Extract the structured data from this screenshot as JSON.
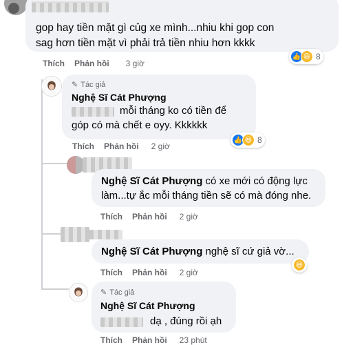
{
  "comment1": {
    "text": "gop hay tiền mặt gì củg xe mình...nhiu khi gop con sag hơn tiền mặt vì phải trả tiền nhiu hơn kkkk",
    "actions": {
      "like": "Thích",
      "reply": "Phản hồi",
      "time": "3 giờ"
    },
    "reactions": {
      "icons": [
        "like-icon",
        "haha-icon"
      ],
      "count": "8"
    }
  },
  "reply1": {
    "author_tag": "Tác giả",
    "author": "Nghệ Sĩ Cát Phượng",
    "text": "mỗi tháng ko có tiền để góp có mà chết e oyy. Kkkkkk",
    "actions": {
      "like": "Thích",
      "reply": "Phản hồi",
      "time": "2 giờ"
    },
    "reactions": {
      "icons": [
        "like-icon",
        "haha-icon"
      ],
      "count": "8"
    }
  },
  "reply2": {
    "mention": "Nghệ Sĩ Cát Phượng",
    "text": "có xe mới có động lực làm...tự ắc mỗi tháng tiền sẽ có mà đóng nhe.",
    "actions": {
      "like": "Thích",
      "reply": "Phản hồi",
      "time": "2 giờ"
    }
  },
  "reply3": {
    "mention": "Nghệ Sĩ Cát Phượng",
    "text": "nghệ sĩ cứ giả vờ...",
    "actions": {
      "like": "Thích",
      "reply": "Phản hồi",
      "time": "2 giờ"
    },
    "reactions": {
      "icons": [
        "haha-icon"
      ]
    }
  },
  "reply4": {
    "author_tag": "Tác giả",
    "author": "Nghệ Sĩ Cát Phượng",
    "text": "dạ , đúng rồi ạh",
    "actions": {
      "like": "Thích",
      "reply": "Phản hồi",
      "time": "23 phút"
    }
  },
  "colors": {
    "bubble": "#f0f2f5",
    "like": "#1877f2",
    "haha": "#f7b928",
    "meta": "#65676b"
  }
}
